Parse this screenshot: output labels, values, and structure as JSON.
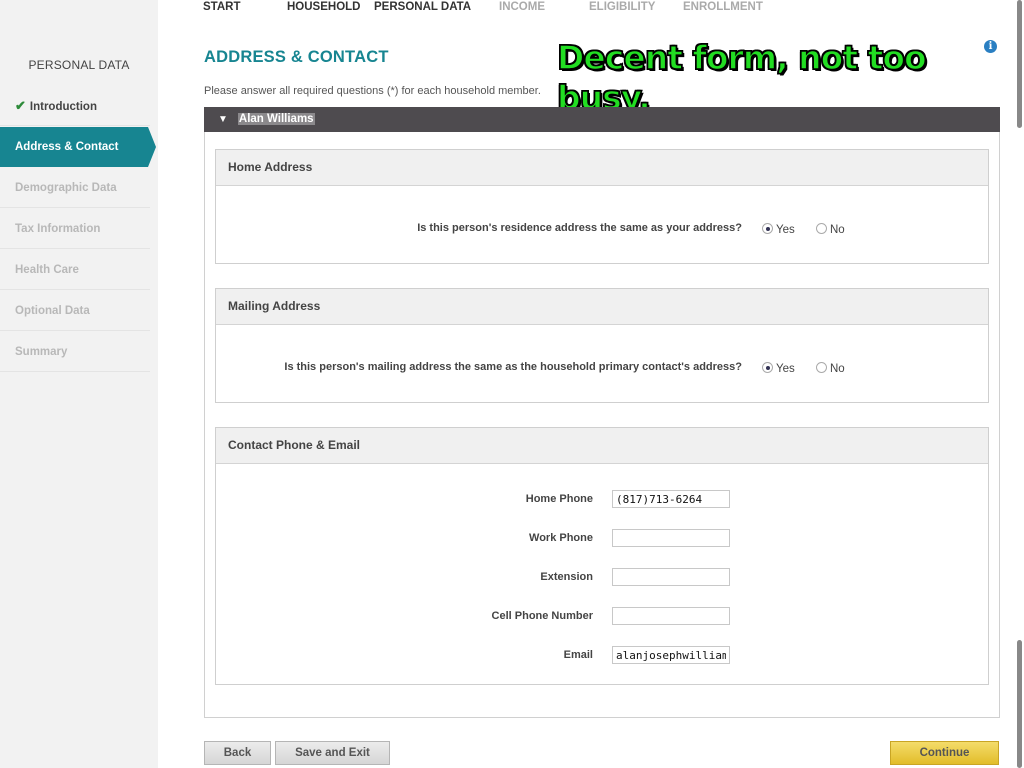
{
  "nav": {
    "steps": [
      {
        "label": "START",
        "state": "done"
      },
      {
        "label": "HOUSEHOLD",
        "state": "done"
      },
      {
        "label": "PERSONAL DATA",
        "state": "current"
      },
      {
        "label": "INCOME",
        "state": "pending"
      },
      {
        "label": "ELIGIBILITY",
        "state": "pending"
      },
      {
        "label": "ENROLLMENT",
        "state": "pending"
      }
    ]
  },
  "sidebar": {
    "heading": "PERSONAL DATA",
    "items": [
      {
        "label": "Introduction",
        "state": "done"
      },
      {
        "label": "Address & Contact",
        "state": "active"
      },
      {
        "label": "Demographic Data",
        "state": "pending"
      },
      {
        "label": "Tax Information",
        "state": "pending"
      },
      {
        "label": "Health Care",
        "state": "pending"
      },
      {
        "label": "Optional Data",
        "state": "pending"
      },
      {
        "label": "Summary",
        "state": "pending"
      }
    ]
  },
  "page": {
    "title": "ADDRESS & CONTACT",
    "instructions": "Please answer all required questions (*) for each household member.",
    "overlay_note": "Decent form, not too busy.",
    "info_icon": "i"
  },
  "person": {
    "name": "Alan Williams",
    "expander_icon": "chevron-down-icon"
  },
  "sections": {
    "home_address": {
      "title": "Home Address",
      "question": "Is this person's residence address the same as your address?",
      "yes_label": "Yes",
      "no_label": "No",
      "selected": "Yes"
    },
    "mailing_address": {
      "title": "Mailing Address",
      "question": "Is this person's mailing address the same as the household primary contact's address?",
      "yes_label": "Yes",
      "no_label": "No",
      "selected": "Yes"
    },
    "contact": {
      "title": "Contact Phone & Email",
      "fields": {
        "home_phone": {
          "label": "Home Phone",
          "value": "(817)713-6264"
        },
        "work_phone": {
          "label": "Work Phone",
          "value": ""
        },
        "extension": {
          "label": "Extension",
          "value": ""
        },
        "cell_phone": {
          "label": "Cell Phone Number",
          "value": ""
        },
        "email": {
          "label": "Email",
          "value": "alanjosephwilliam@g"
        }
      }
    }
  },
  "buttons": {
    "back": "Back",
    "save_exit": "Save and Exit",
    "continue": "Continue"
  },
  "colors": {
    "accent": "#178591",
    "sidebar_bg": "#f2f2f2",
    "person_bar": "#4e4b4f",
    "continue_button": "#e9c83f",
    "overlay_text": "#22dd22"
  }
}
